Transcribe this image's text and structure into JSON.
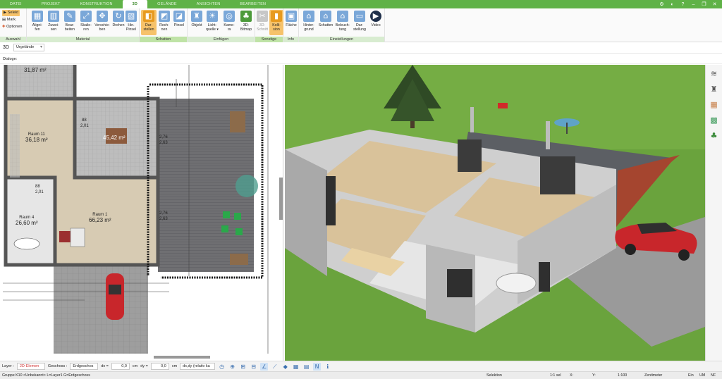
{
  "tabs": [
    "DATEI",
    "PROJEKT",
    "KONSTRUKTION",
    "3D",
    "GELÄNDE",
    "ANSICHTEN",
    "BEARBEITEN"
  ],
  "active_tab": "3D",
  "ribbon": {
    "auswahl": {
      "label": "Auswahl",
      "select": "Selekt",
      "mark": "Mark.",
      "options": "Optionen"
    },
    "material": {
      "label": "Material",
      "buttons": [
        "Aligni-\nfen",
        "Zuwei-\nsen",
        "Bear-\nbeiten",
        "Skalie-\nren",
        "Verschie-\nben",
        "Drehen",
        "Hin.\nPinsel"
      ]
    },
    "schatten": {
      "label": "Schatten",
      "buttons": [
        "Dar-\nstellen",
        "Rech-\nnen",
        "Pinsel"
      ]
    },
    "einfuegen": {
      "label": "Einfügen",
      "buttons": [
        "Objekt",
        "Licht-\nquelle ▾",
        "Kame-\nra",
        "3D-\nBitmap"
      ]
    },
    "sonstige": {
      "label": "Sonstige",
      "buttons": [
        "3D-\nSchnitt",
        "Kolli-\nsion"
      ]
    },
    "info": {
      "label": "Info",
      "buttons": [
        "Fläche"
      ]
    },
    "einstellungen": {
      "label": "Einstellungen",
      "buttons": [
        "Hinter-\ngrund",
        "Schatten",
        "Beleuch-\ntung",
        "Dar-\nstellung",
        "Video"
      ]
    }
  },
  "view_row": {
    "mode": "3D",
    "selection": "Urgelände"
  },
  "dialog_label": "Dialoge:",
  "plan": {
    "rooms": [
      {
        "name": "",
        "area": "31,87 m²"
      },
      {
        "name": "Raum 11",
        "area": "36,18 m²"
      },
      {
        "name": "",
        "area": "45,42 m²"
      },
      {
        "name": "Raum 1",
        "area": "66,23 m²"
      },
      {
        "name": "Raum 4",
        "area": "26,60 m²"
      }
    ],
    "dimensions": [
      "2,76",
      "2,63",
      "2,76",
      "2,63",
      "88",
      "2,01",
      "88",
      "2,01"
    ]
  },
  "bottom_toolbar": {
    "layer_label": "Layer :",
    "layer_value": "2D-Elemen",
    "floor_label": "Geschoss :",
    "floor_value": "Erdgeschos",
    "dx_label": "dx =",
    "dx_value": "0,0",
    "dx_unit": "cm",
    "dy_label": "dy =",
    "dy_value": "0,0",
    "dy_unit": "cm",
    "mode": "dx,dy (relativ ka"
  },
  "status": {
    "left": "Gruppe K10 <Unbekannt> L=Layer1 G=Erdgeschoss",
    "mode": "Selektion",
    "scale": "1:1 sel",
    "x": "X:",
    "y": "Y:",
    "zoom": "1:100",
    "unit": "Zentimeter",
    "ein": "Ein",
    "um": "UM",
    "nf": "NF"
  },
  "colors": {
    "accent": "#5fb247",
    "ribbon_selected": "#f6c26a",
    "car": "#c8262b",
    "grass": "#6aa33d"
  }
}
